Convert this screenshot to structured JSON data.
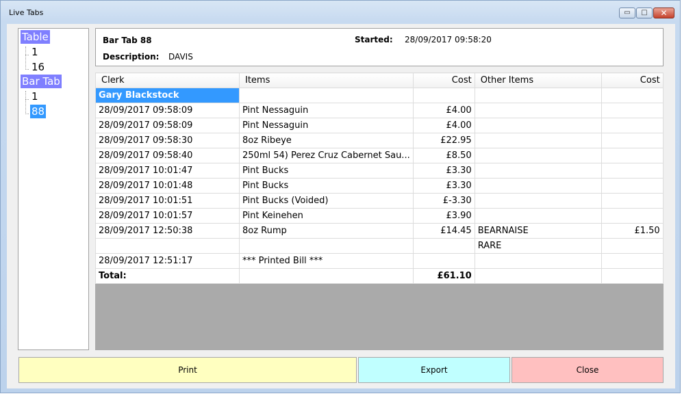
{
  "window": {
    "title": "Live Tabs"
  },
  "titlebar_buttons": {
    "minimize": "▭",
    "maximize": "□",
    "close": "✕"
  },
  "tree": {
    "groups": [
      {
        "label": "Table",
        "children": [
          "1",
          "16"
        ]
      },
      {
        "label": "Bar Tab",
        "children": [
          "1",
          "88"
        ]
      }
    ],
    "selected": "Bar Tab / 88"
  },
  "header": {
    "tab_name": "Bar Tab 88",
    "started_label": "Started:",
    "started_value": "28/09/2017 09:58:20",
    "description_label": "Description:",
    "description_value": "DAVIS"
  },
  "grid": {
    "columns": [
      "Clerk",
      "Items",
      "Cost",
      "Other Items",
      "Cost"
    ],
    "clerk_row": "Gary Blackstock",
    "rows": [
      [
        "28/09/2017 09:58:09",
        "Pint Nessaguin",
        "£4.00",
        "",
        ""
      ],
      [
        "28/09/2017 09:58:09",
        "Pint Nessaguin",
        "£4.00",
        "",
        ""
      ],
      [
        "28/09/2017 09:58:30",
        "8oz Ribeye",
        "£22.95",
        "",
        ""
      ],
      [
        "28/09/2017 09:58:40",
        "250ml 54) Perez Cruz Cabernet Sau...",
        "£8.50",
        "",
        ""
      ],
      [
        "28/09/2017 10:01:47",
        "Pint Bucks",
        "£3.30",
        "",
        ""
      ],
      [
        "28/09/2017 10:01:48",
        "Pint Bucks",
        "£3.30",
        "",
        ""
      ],
      [
        "28/09/2017 10:01:51",
        "Pint Bucks (Voided)",
        "£-3.30",
        "",
        ""
      ],
      [
        "28/09/2017 10:01:57",
        "Pint Keinehen",
        "£3.90",
        "",
        ""
      ],
      [
        "28/09/2017 12:50:38",
        "8oz Rump",
        "£14.45",
        "BEARNAISE",
        "£1.50"
      ],
      [
        "",
        "",
        "",
        "RARE",
        ""
      ],
      [
        "28/09/2017 12:51:17",
        "*** Printed Bill ***",
        "",
        "",
        ""
      ]
    ],
    "total_label": "Total:",
    "total_value": "£61.10"
  },
  "buttons": {
    "print": "Print",
    "export": "Export",
    "close": "Close"
  },
  "colors": {
    "print_bg": "#ffffc0",
    "export_bg": "#c0ffff",
    "close_bg": "#ffc0c0",
    "selection": "#3399ff",
    "tree_group_selection": "#7f7fff"
  }
}
